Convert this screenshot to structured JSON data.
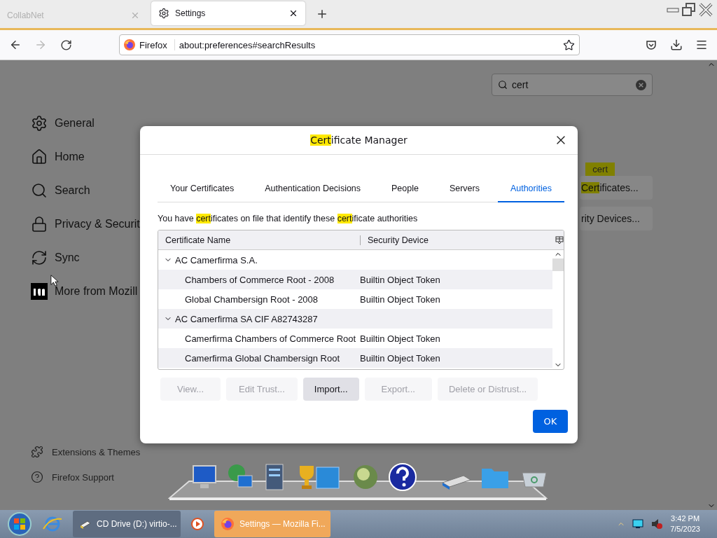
{
  "browser_tabs": [
    {
      "title": "CollabNet",
      "selected": false
    },
    {
      "title": "Settings",
      "selected": true
    }
  ],
  "address_bar": {
    "identity": "Firefox",
    "url": "about:preferences#searchResults"
  },
  "settings_search": {
    "value": "cert"
  },
  "sidebar": {
    "items": [
      {
        "label": "General",
        "kind": "general"
      },
      {
        "label": "Home",
        "kind": "home"
      },
      {
        "label": "Search",
        "kind": "search"
      },
      {
        "label": "Privacy & Securit",
        "kind": "privacy"
      },
      {
        "label": "Sync",
        "kind": "sync"
      },
      {
        "label": "More from Mozill",
        "kind": "more"
      }
    ],
    "footer_items": [
      {
        "label": "Extensions & Themes",
        "kind": "extensions"
      },
      {
        "label": "Firefox Support",
        "kind": "support"
      }
    ]
  },
  "background_results": {
    "tooltip": "cert",
    "buttons": [
      [
        {
          "text": "Cert",
          "highlighted": true
        },
        {
          "text": "ificates...",
          "highlighted": false
        }
      ],
      [
        {
          "text": "rity Devices...",
          "highlighted": false
        }
      ]
    ]
  },
  "dialog": {
    "title": [
      {
        "text": "Cert",
        "highlighted": true
      },
      {
        "text": "ificate Manager",
        "highlighted": false
      }
    ],
    "tabs": [
      {
        "label": "Your Certificates",
        "selected": false
      },
      {
        "label": "Authentication Decisions",
        "selected": false
      },
      {
        "label": "People",
        "selected": false
      },
      {
        "label": "Servers",
        "selected": false
      },
      {
        "label": "Authorities",
        "selected": true
      }
    ],
    "description": [
      {
        "text": "You have ",
        "highlighted": false
      },
      {
        "text": "cert",
        "highlighted": true
      },
      {
        "text": "ificates on file that identify these ",
        "highlighted": false
      },
      {
        "text": "cert",
        "highlighted": true
      },
      {
        "text": "ificate authorities",
        "highlighted": false
      }
    ],
    "table": {
      "columns": [
        "Certificate Name",
        "Security Device"
      ],
      "rows": [
        {
          "name": "AC Camerfirma S.A.",
          "expanded": true,
          "children": [
            {
              "name": "Chambers of Commerce Root - 2008",
              "device": "Builtin Object Token"
            },
            {
              "name": "Global Chambersign Root - 2008",
              "device": "Builtin Object Token"
            }
          ]
        },
        {
          "name": "AC Camerfirma SA CIF A82743287",
          "expanded": true,
          "children": [
            {
              "name": "Camerfirma Chambers of Commerce Root",
              "device": "Builtin Object Token"
            },
            {
              "name": "Camerfirma Global Chambersign Root",
              "device": "Builtin Object Token"
            }
          ]
        }
      ]
    },
    "buttons": [
      {
        "label": "View...",
        "disabled": true
      },
      {
        "label": "Edit Trust...",
        "disabled": true
      },
      {
        "label": "Import...",
        "disabled": false
      },
      {
        "label": "Export...",
        "disabled": true
      },
      {
        "label": "Delete or Distrust...",
        "disabled": true
      }
    ],
    "ok": "OK"
  },
  "taskbar": {
    "tasks": [
      {
        "label": "CD Drive (D:) virtio-...",
        "kind": "drive",
        "active": false
      },
      {
        "label": "Settings — Mozilla Fi...",
        "kind": "firefox",
        "active": true
      }
    ],
    "clock": {
      "time": "3:42 PM",
      "date": "7/5/2023"
    }
  }
}
